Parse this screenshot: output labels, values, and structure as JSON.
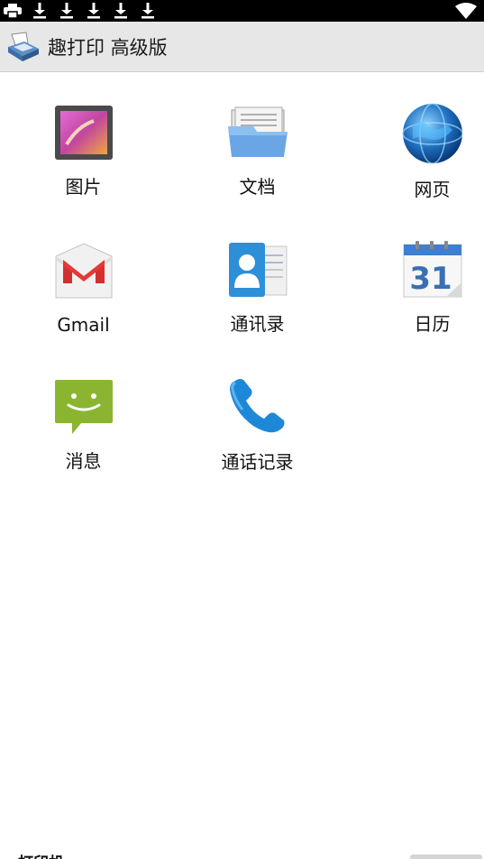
{
  "status_bar": {
    "left_icons": [
      "printer-icon",
      "download-icon",
      "download-icon",
      "download-icon",
      "download-icon",
      "download-icon"
    ],
    "right_icons": [
      "wifi-icon"
    ]
  },
  "action_bar": {
    "title": "趣打印 高级版",
    "logo": "printer-logo-icon"
  },
  "grid": {
    "items": [
      {
        "label": "图片",
        "icon": "gallery-icon"
      },
      {
        "label": "文档",
        "icon": "folder-icon"
      },
      {
        "label": "网页",
        "icon": "globe-icon"
      },
      {
        "label": "Gmail",
        "icon": "gmail-icon"
      },
      {
        "label": "通讯录",
        "icon": "contacts-icon"
      },
      {
        "label": "日历",
        "icon": "calendar-icon"
      },
      {
        "label": "消息",
        "icon": "messages-icon"
      },
      {
        "label": "通话记录",
        "icon": "phone-icon"
      }
    ],
    "calendar_day": "31"
  },
  "bottom_sheet": {
    "label": "打印机"
  },
  "colors": {
    "status_bar": "#000000",
    "action_bar": "#e7e7e7",
    "background": "#ffffff"
  }
}
